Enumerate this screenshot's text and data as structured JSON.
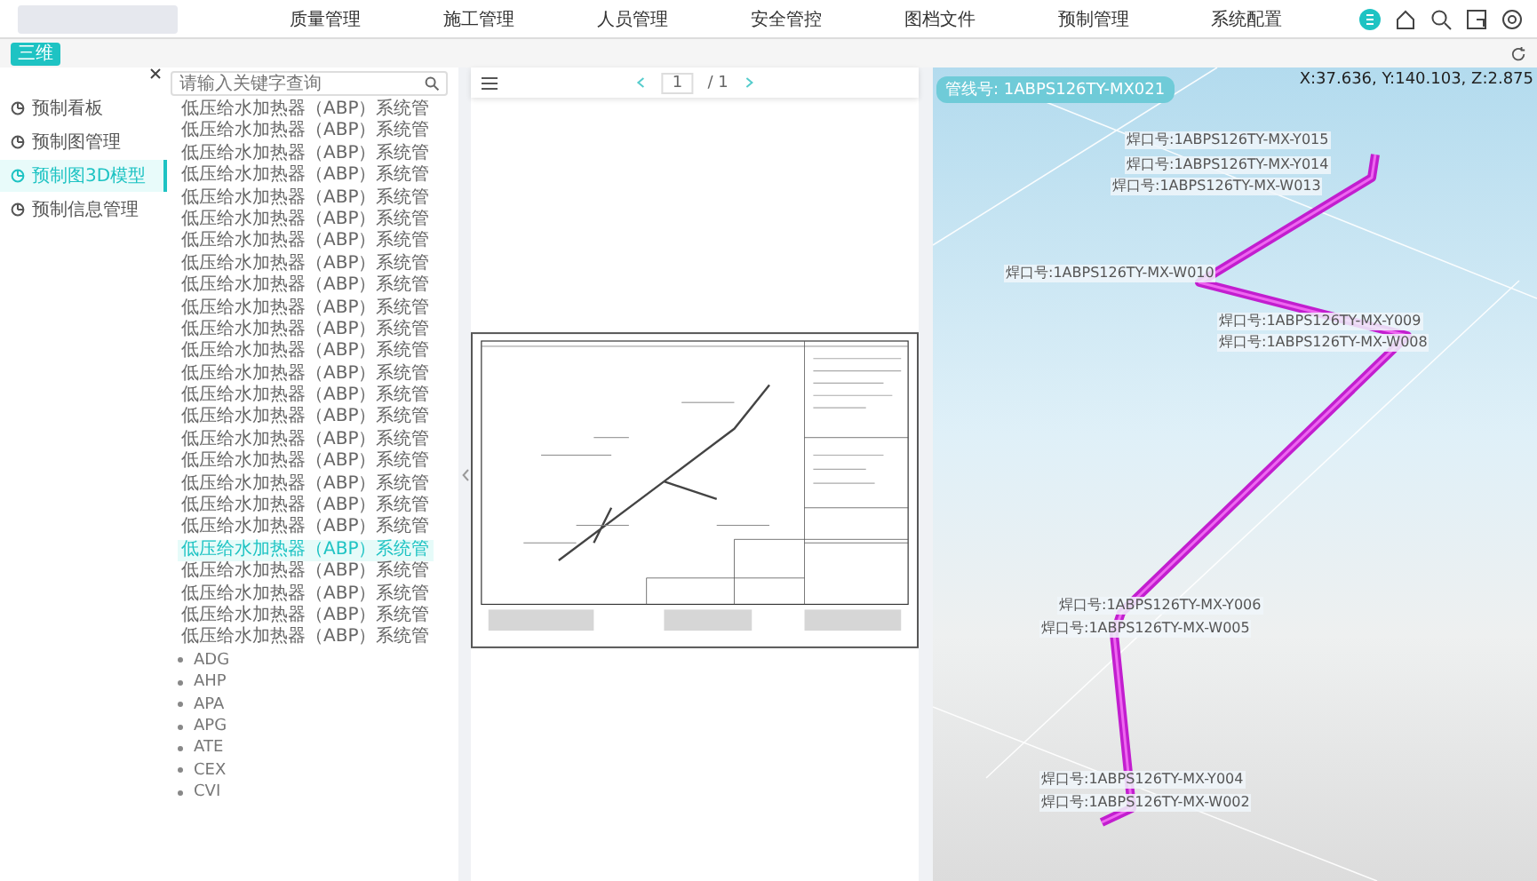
{
  "header": {
    "nav": [
      {
        "label": "质量管理",
        "selected": false
      },
      {
        "label": "施工管理",
        "selected": false
      },
      {
        "label": "人员管理",
        "selected": false
      },
      {
        "label": "安全管控",
        "selected": false
      },
      {
        "label": "图档文件",
        "selected": false
      },
      {
        "label": "预制管理",
        "selected": false
      },
      {
        "label": "系统配置",
        "selected": false
      }
    ]
  },
  "toolbar": {
    "view_button": "三维"
  },
  "sidebar": {
    "items": [
      {
        "label": "预制看板",
        "selected": false
      },
      {
        "label": "预制图管理",
        "selected": false
      },
      {
        "label": "预制图3D模型",
        "selected": true
      },
      {
        "label": "预制信息管理",
        "selected": false
      }
    ]
  },
  "tree": {
    "placeholder": "请输入关键字查询",
    "items": [
      {
        "label": "低压给水加热器（ABP）系统管",
        "selected": false
      },
      {
        "label": "低压给水加热器（ABP）系统管",
        "selected": false
      },
      {
        "label": "低压给水加热器（ABP）系统管",
        "selected": false
      },
      {
        "label": "低压给水加热器（ABP）系统管",
        "selected": false
      },
      {
        "label": "低压给水加热器（ABP）系统管",
        "selected": false
      },
      {
        "label": "低压给水加热器（ABP）系统管",
        "selected": false
      },
      {
        "label": "低压给水加热器（ABP）系统管",
        "selected": false
      },
      {
        "label": "低压给水加热器（ABP）系统管",
        "selected": false
      },
      {
        "label": "低压给水加热器（ABP）系统管",
        "selected": false
      },
      {
        "label": "低压给水加热器（ABP）系统管",
        "selected": false
      },
      {
        "label": "低压给水加热器（ABP）系统管",
        "selected": false
      },
      {
        "label": "低压给水加热器（ABP）系统管",
        "selected": false
      },
      {
        "label": "低压给水加热器（ABP）系统管",
        "selected": false
      },
      {
        "label": "低压给水加热器（ABP）系统管",
        "selected": false
      },
      {
        "label": "低压给水加热器（ABP）系统管",
        "selected": false
      },
      {
        "label": "低压给水加热器（ABP）系统管",
        "selected": false
      },
      {
        "label": "低压给水加热器（ABP）系统管",
        "selected": false
      },
      {
        "label": "低压给水加热器（ABP）系统管",
        "selected": false
      },
      {
        "label": "低压给水加热器（ABP）系统管",
        "selected": false
      },
      {
        "label": "低压给水加热器（ABP）系统管",
        "selected": false
      },
      {
        "label": "低压给水加热器（ABP）系统管",
        "selected": true
      },
      {
        "label": "低压给水加热器（ABP）系统管",
        "selected": false
      },
      {
        "label": "低压给水加热器（ABP）系统管",
        "selected": false
      },
      {
        "label": "低压给水加热器（ABP）系统管",
        "selected": false
      },
      {
        "label": "低压给水加热器（ABP）系统管",
        "selected": false
      }
    ],
    "groups": [
      {
        "label": "ADG"
      },
      {
        "label": "AHP"
      },
      {
        "label": "APA"
      },
      {
        "label": "APG"
      },
      {
        "label": "ATE"
      },
      {
        "label": "CEX"
      },
      {
        "label": "CVI"
      }
    ]
  },
  "viewer": {
    "page": "1",
    "total": "/ 1"
  },
  "model": {
    "pipe_label": "管线号: 1ABPS126TY-MX021",
    "coordinates": "X:37.636, Y:140.103, Z:2.875",
    "welds": [
      {
        "label": "焊口号:1ABPS126TY-MX-Y015"
      },
      {
        "label": "焊口号:1ABPS126TY-MX-Y014"
      },
      {
        "label": "焊口号:1ABPS126TY-MX-W013"
      },
      {
        "label": "焊口号:1ABPS126TY-MX-W010"
      },
      {
        "label": "焊口号:1ABPS126TY-MX-Y009"
      },
      {
        "label": "焊口号:1ABPS126TY-MX-W008"
      },
      {
        "label": "焊口号:1ABPS126TY-MX-Y006"
      },
      {
        "label": "焊口号:1ABPS126TY-MX-W005"
      },
      {
        "label": "焊口号:1ABPS126TY-MX-Y004"
      },
      {
        "label": "焊口号:1ABPS126TY-MX-W002"
      }
    ]
  }
}
